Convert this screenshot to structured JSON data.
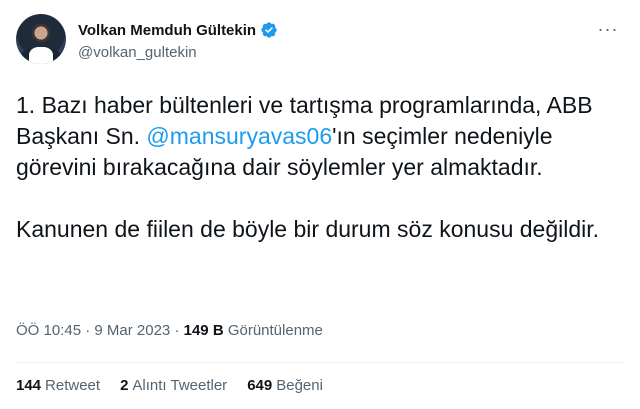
{
  "user": {
    "display_name": "Volkan Memduh Gültekin",
    "handle": "@volkan_gultekin"
  },
  "tweet": {
    "line1_pre": "1. Bazı haber bültenleri ve tartışma programlarında, ABB Başkanı Sn. ",
    "mention": "@mansuryavas06",
    "line1_post": "'ın seçimler nedeniyle görevini bırakacağına dair söylemler yer almaktadır.",
    "paragraph2": "Kanunen de fiilen de böyle bir durum söz konusu değildir."
  },
  "meta": {
    "time": "ÖÖ 10:45",
    "separator": "·",
    "date": "9 Mar 2023",
    "views_count": "149 B",
    "views_label": "Görüntülenme"
  },
  "stats": {
    "retweets_count": "144",
    "retweets_label": "Retweet",
    "quotes_count": "2",
    "quotes_label": "Alıntı Tweetler",
    "likes_count": "649",
    "likes_label": "Beğeni"
  },
  "colors": {
    "accent": "#1d9bf0",
    "text": "#0f1419",
    "secondary": "#536471",
    "divider": "#eff3f4"
  },
  "icons": {
    "verified": "verified-badge-icon",
    "more": "more-horizontal-icon"
  }
}
